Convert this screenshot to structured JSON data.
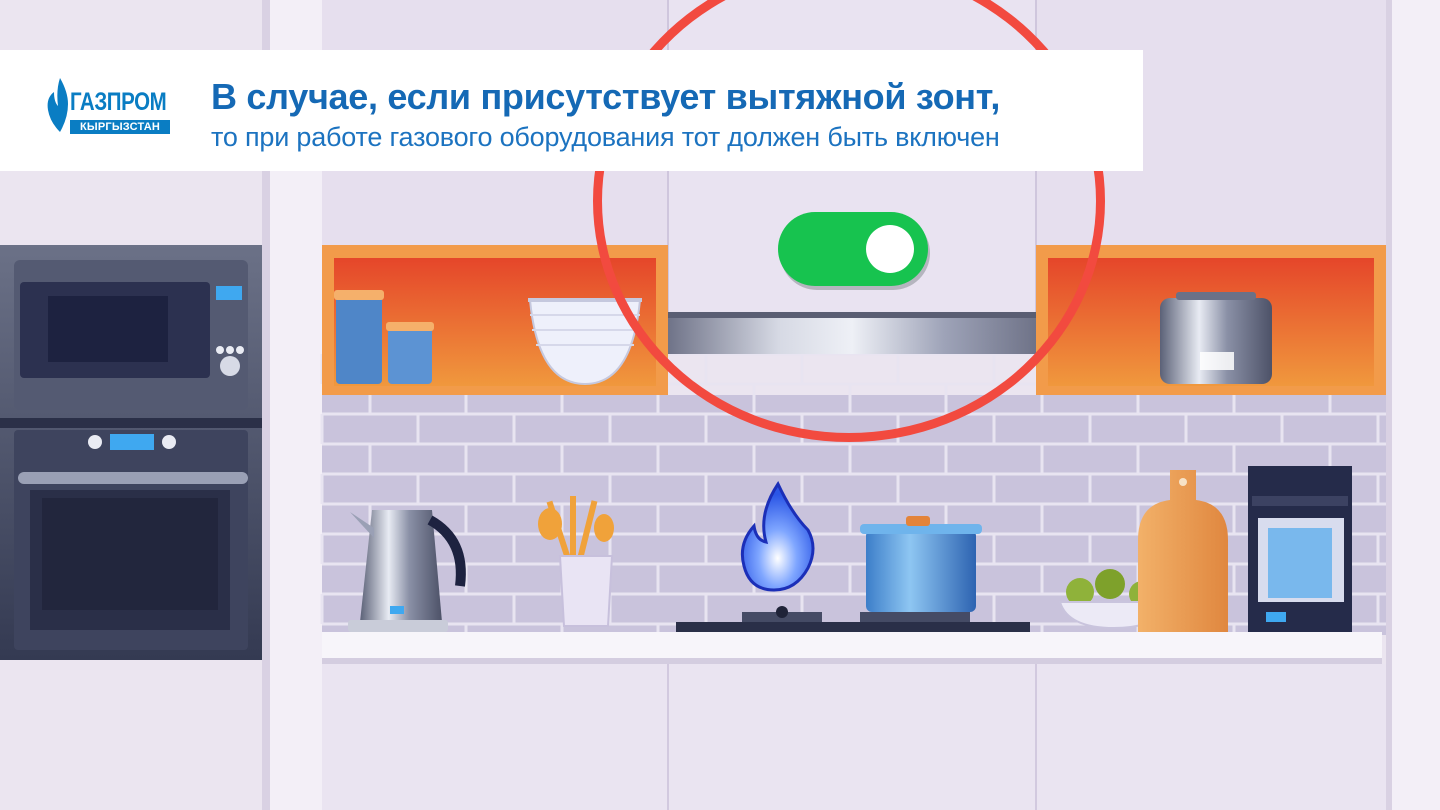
{
  "brand": {
    "name": "ГАЗПРОМ",
    "region": "КЫРГЫЗСТАН",
    "color": "#0a7dc3"
  },
  "message": {
    "headline": "В случае, если присутствует вытяжной зонт,",
    "subline": "то при работе газового оборудования тот должен быть включен"
  },
  "hood_switch": {
    "state": "on",
    "color": "#17c34f"
  },
  "highlight_color": "#f24a3f",
  "flame_color": "#2b56e6"
}
